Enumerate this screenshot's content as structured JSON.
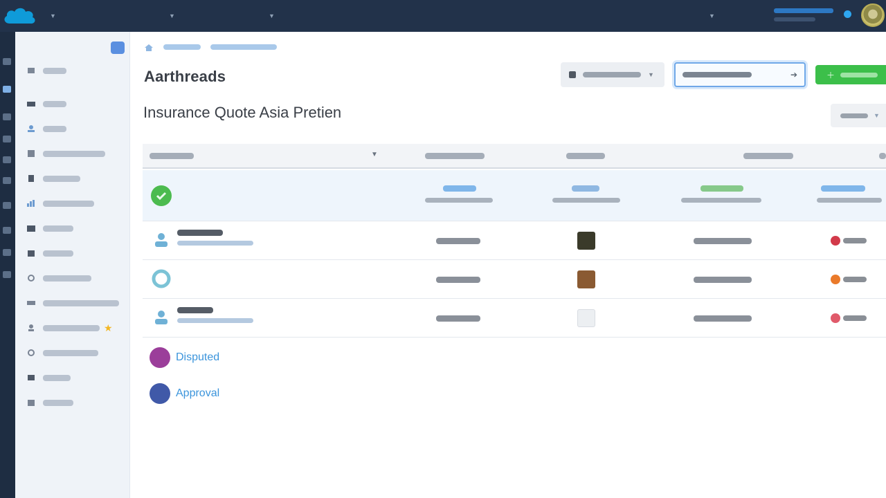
{
  "colors": {
    "topbar_bg": "#22324a",
    "sidebar_bg": "#eff3f8",
    "accent_blue": "#3c95dc",
    "primary_green": "#3cbf4a",
    "status_green": "#4cbb4f",
    "status_purple": "#9b3e9a",
    "status_indigo": "#4059a8"
  },
  "topbar": {
    "app_name": "",
    "nav": [
      "",
      "",
      "",
      ""
    ],
    "user_menu": "",
    "icons": [
      "cloud-logo-icon",
      "chevron-down-icon",
      "notification-dot-icon",
      "avatar"
    ]
  },
  "sidebar": {
    "header": "",
    "items": [
      {
        "label": "",
        "icon": "home-icon"
      },
      {
        "label": "",
        "icon": "inbox-icon"
      },
      {
        "label": "",
        "icon": "users-icon"
      },
      {
        "label": "",
        "icon": "grid-icon"
      },
      {
        "label": "",
        "icon": "document-icon"
      },
      {
        "label": "",
        "icon": "chart-icon"
      },
      {
        "label": "",
        "icon": "folder-icon"
      },
      {
        "label": "",
        "icon": "calendar-icon"
      },
      {
        "label": "",
        "icon": "link-icon"
      },
      {
        "label": "",
        "icon": "settings-icon"
      },
      {
        "label": "",
        "icon": "person-star-icon"
      },
      {
        "label": "",
        "icon": "refresh-icon"
      },
      {
        "label": "",
        "icon": "box-icon"
      },
      {
        "label": "",
        "icon": "archive-icon"
      }
    ]
  },
  "breadcrumb": {
    "items": [
      "",
      ""
    ]
  },
  "page": {
    "heading": "Aarthreads",
    "subtitle": "Insurance Quote Asia Pretien"
  },
  "toolbar": {
    "view_selector": "",
    "search_placeholder": "",
    "primary_action": "",
    "filter": ""
  },
  "table": {
    "columns": [
      "",
      "",
      "",
      "",
      ""
    ],
    "rows": [
      {
        "type": "summary",
        "icon": "check-circle-icon"
      },
      {
        "type": "item",
        "icon": "user-group-icon",
        "thumb_color": "#3a3a2a",
        "badge_color": "#d23a4a"
      },
      {
        "type": "item",
        "icon": "ring-icon",
        "thumb_color": "#8a5a32",
        "badge_color": "#ea7a2a"
      },
      {
        "type": "item",
        "icon": "user-group-icon",
        "thumb_color": "#eceff2",
        "badge_color": "#e05a6a"
      }
    ]
  },
  "statuses": [
    {
      "label": "Disputed",
      "color": "#9b3e9a"
    },
    {
      "label": "Approval",
      "color": "#4059a8"
    }
  ]
}
